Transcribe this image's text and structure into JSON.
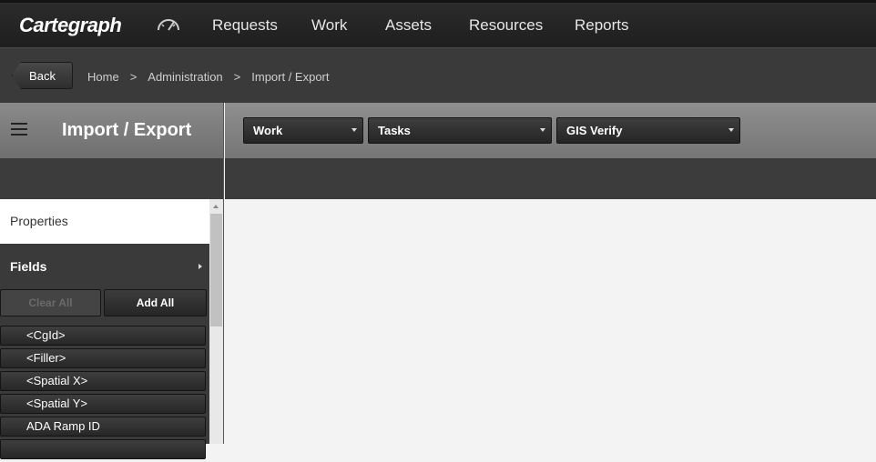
{
  "app": {
    "logo_text": "Cartegraph"
  },
  "nav": {
    "items": [
      {
        "label": "Requests"
      },
      {
        "label": "Work"
      },
      {
        "label": "Assets"
      },
      {
        "label": "Resources"
      },
      {
        "label": "Reports"
      }
    ]
  },
  "breadcrumb": {
    "back_label": "Back",
    "items": [
      "Home",
      "Administration",
      "Import / Export"
    ],
    "separator": ">"
  },
  "header": {
    "title": "Import / Export",
    "selects": [
      {
        "value": "Work"
      },
      {
        "value": "Tasks"
      },
      {
        "value": "GIS Verify"
      }
    ]
  },
  "sidebar": {
    "properties_label": "Properties",
    "fields_label": "Fields",
    "clear_all_label": "Clear All",
    "add_all_label": "Add All",
    "fields": [
      {
        "label": "<CgId>"
      },
      {
        "label": "<Filler>"
      },
      {
        "label": "<Spatial X>"
      },
      {
        "label": "<Spatial Y>"
      },
      {
        "label": "ADA Ramp ID"
      },
      {
        "label": ""
      }
    ]
  },
  "colors": {
    "topbar": "#1e1e1e",
    "crumbbar": "#3a3a3a",
    "titlebar": "#7d7d7d",
    "panel": "#3a3a3a",
    "content": "#f3f3f3"
  }
}
